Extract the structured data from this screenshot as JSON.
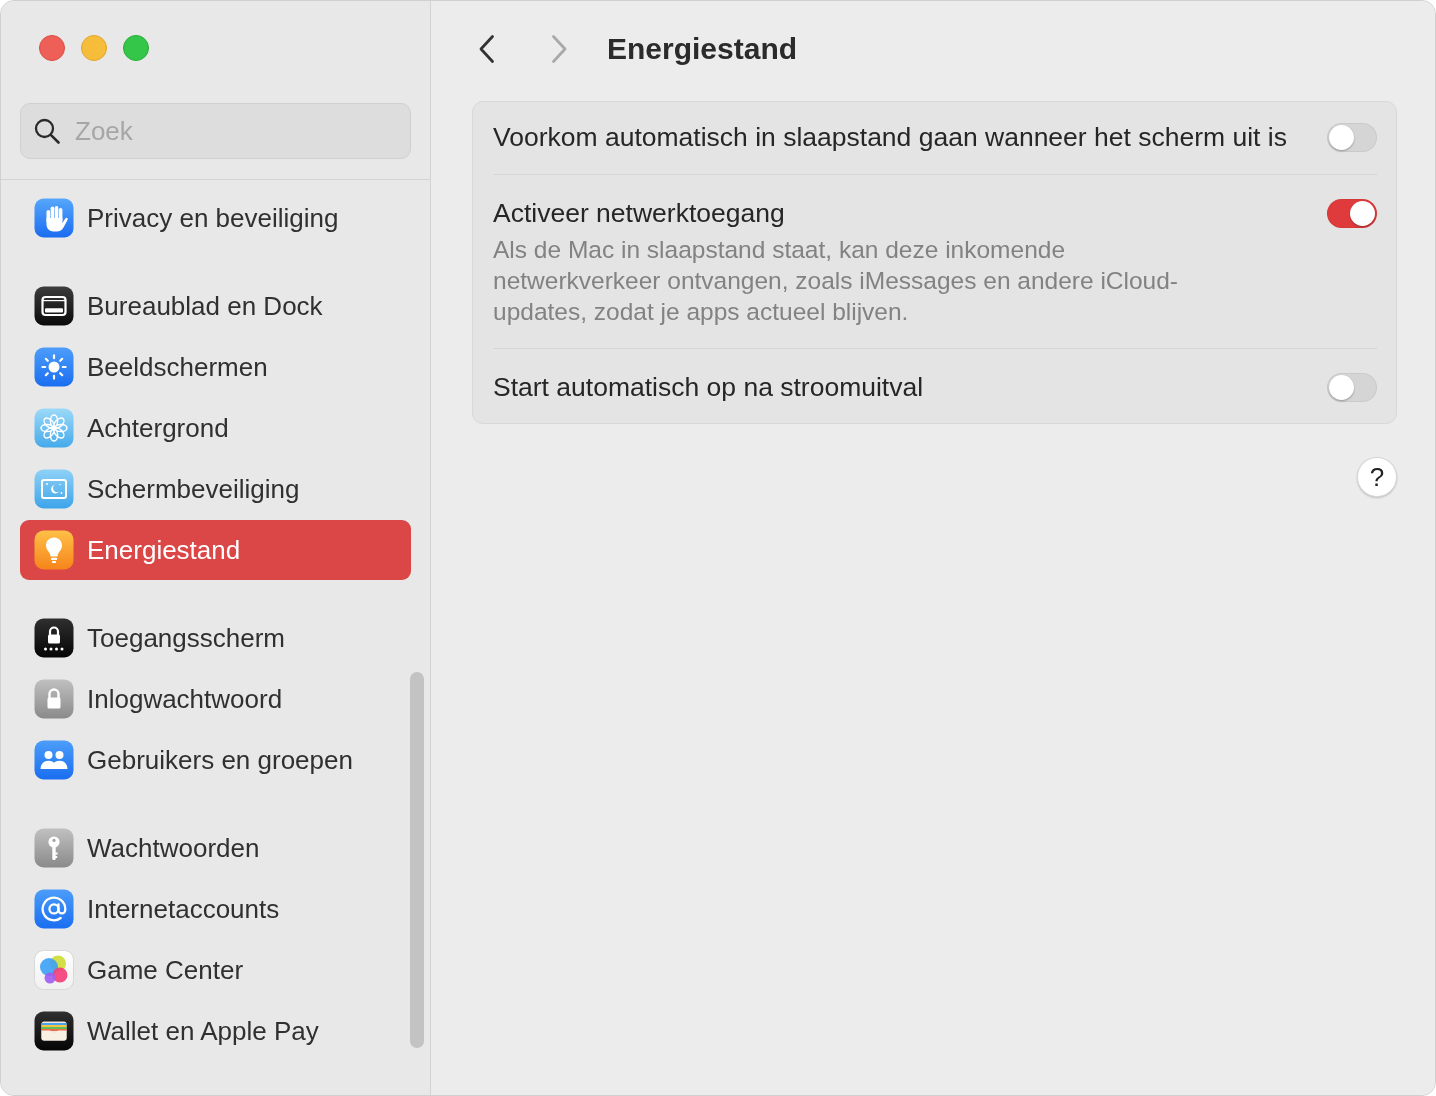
{
  "sidebar": {
    "search": {
      "placeholder": "Zoek"
    },
    "groups": [
      {
        "items": [
          {
            "label": "Privacy en beveiliging",
            "selected": false
          }
        ]
      },
      {
        "items": [
          {
            "label": "Bureaublad en Dock",
            "selected": false
          },
          {
            "label": "Beeldschermen",
            "selected": false
          },
          {
            "label": "Achtergrond",
            "selected": false
          },
          {
            "label": "Schermbeveiliging",
            "selected": false
          },
          {
            "label": "Energiestand",
            "selected": true
          }
        ]
      },
      {
        "items": [
          {
            "label": "Toegangsscherm",
            "selected": false
          },
          {
            "label": "Inlogwachtwoord",
            "selected": false
          },
          {
            "label": "Gebruikers en groepen",
            "selected": false
          }
        ]
      },
      {
        "items": [
          {
            "label": "Wachtwoorden",
            "selected": false
          },
          {
            "label": "Internetaccounts",
            "selected": false
          },
          {
            "label": "Game Center",
            "selected": false
          },
          {
            "label": "Wallet en Apple Pay",
            "selected": false
          }
        ]
      }
    ]
  },
  "toolbar": {
    "back": {
      "disabled": false
    },
    "forward": {
      "disabled": true
    },
    "title": "Energiestand"
  },
  "settings": {
    "rows": [
      {
        "label": "Voorkom automatisch in slaapstand gaan wanneer het scherm uit is",
        "on": false
      },
      {
        "label": "Activeer netwerktoegang",
        "description": "Als de Mac in slaapstand staat, kan deze inkomende netwerkverkeer ontvangen, zoals iMessages en andere iCloud-updates, zodat je apps actueel blijven.",
        "on": true
      },
      {
        "label": "Start automatisch op na stroomuitval",
        "on": false
      }
    ]
  },
  "help_button": {
    "label": "?"
  }
}
